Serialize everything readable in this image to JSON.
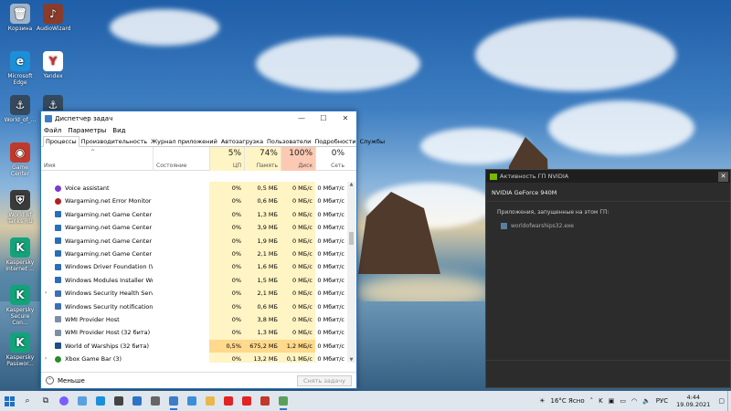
{
  "desktop": {
    "icons": [
      {
        "label": "Корзина",
        "color": "#9fb4c8",
        "glyph": "🗑"
      },
      {
        "label": "AudioWizard",
        "color": "#8a3b2a",
        "glyph": "♪"
      },
      {
        "label": "Microsoft Edge",
        "color": "#1c8fd8",
        "glyph": "e"
      },
      {
        "label": "Yandex",
        "color": "#ffffff",
        "glyph": "Y"
      },
      {
        "label": "World_of_...",
        "color": "#34495e",
        "glyph": "⚓"
      },
      {
        "label": "",
        "color": "#34495e",
        "glyph": "⚓"
      },
      {
        "label": "Game Center",
        "color": "#c0392b",
        "glyph": "◉"
      },
      {
        "label": "World of Tanks RU",
        "color": "#3a3a3a",
        "glyph": "⛨"
      },
      {
        "label": "Kaspersky Internet ...",
        "color": "#13a37a",
        "glyph": "K"
      },
      {
        "label": "Kaspersky Secure Con...",
        "color": "#13a37a",
        "glyph": "K"
      },
      {
        "label": "Kaspersky Passwor...",
        "color": "#13a37a",
        "glyph": "K"
      }
    ]
  },
  "taskmanager": {
    "title": "Диспетчер задач",
    "menu": [
      "Файл",
      "Параметры",
      "Вид"
    ],
    "tabs": [
      "Процессы",
      "Производительность",
      "Журнал приложений",
      "Автозагрузка",
      "Пользователи",
      "Подробности",
      "Службы"
    ],
    "active_tab": 0,
    "columns": {
      "name": "Имя",
      "state": "Состояние",
      "cpu": {
        "label": "ЦП",
        "pct": "5%"
      },
      "mem": {
        "label": "Память",
        "pct": "74%"
      },
      "disk": {
        "label": "Диск",
        "pct": "100%"
      },
      "net": {
        "label": "Сеть",
        "pct": "0%"
      }
    },
    "rows": [
      {
        "name": "Voice assistant",
        "icon": "voice",
        "expand": "",
        "cpu": "0%",
        "mem": "0,5 МБ",
        "disk": "0 МБ/с",
        "net": "0 Мбит/с"
      },
      {
        "name": "Wargaming.net Error Monitor (3...",
        "icon": "wg",
        "expand": "",
        "cpu": "0%",
        "mem": "0,6 МБ",
        "disk": "0 МБ/с",
        "net": "0 Мбит/с"
      },
      {
        "name": "Wargaming.net Game Center (3...",
        "icon": "win",
        "expand": "",
        "cpu": "0%",
        "mem": "1,3 МБ",
        "disk": "0 МБ/с",
        "net": "0 Мбит/с"
      },
      {
        "name": "Wargaming.net Game Center (3...",
        "icon": "win",
        "expand": "",
        "cpu": "0%",
        "mem": "3,9 МБ",
        "disk": "0 МБ/с",
        "net": "0 Мбит/с"
      },
      {
        "name": "Wargaming.net Game Center (3...",
        "icon": "win",
        "expand": "",
        "cpu": "0%",
        "mem": "1,9 МБ",
        "disk": "0 МБ/с",
        "net": "0 Мбит/с"
      },
      {
        "name": "Wargaming.net Game Center (3...",
        "icon": "win",
        "expand": "",
        "cpu": "0%",
        "mem": "2,1 МБ",
        "disk": "0 МБ/с",
        "net": "0 Мбит/с"
      },
      {
        "name": "Windows Driver Foundation (W...",
        "icon": "win",
        "expand": "",
        "cpu": "0%",
        "mem": "1,6 МБ",
        "disk": "0 МБ/с",
        "net": "0 Мбит/с"
      },
      {
        "name": "Windows Modules Installer Wor...",
        "icon": "win",
        "expand": "",
        "cpu": "0%",
        "mem": "1,5 МБ",
        "disk": "0 МБ/с",
        "net": "0 Мбит/с"
      },
      {
        "name": "Windows Security Health Service",
        "icon": "shield",
        "expand": "›",
        "cpu": "0%",
        "mem": "2,1 МБ",
        "disk": "0 МБ/с",
        "net": "0 Мбит/с"
      },
      {
        "name": "Windows Security notification ic...",
        "icon": "shield",
        "expand": "",
        "cpu": "0%",
        "mem": "0,6 МБ",
        "disk": "0 МБ/с",
        "net": "0 Мбит/с"
      },
      {
        "name": "WMI Provider Host",
        "icon": "wmi",
        "expand": "",
        "cpu": "0%",
        "mem": "3,8 МБ",
        "disk": "0 МБ/с",
        "net": "0 Мбит/с"
      },
      {
        "name": "WMI Provider Host (32 бита)",
        "icon": "wmi",
        "expand": "",
        "cpu": "0%",
        "mem": "1,3 МБ",
        "disk": "0 МБ/с",
        "net": "0 Мбит/с"
      },
      {
        "name": "World of Warships (32 бита)",
        "icon": "ship",
        "expand": "",
        "cpu": "0,5%",
        "mem": "675,2 МБ",
        "disk": "1,2 МБ/с",
        "net": "0 Мбит/с",
        "hot": true
      },
      {
        "name": "Xbox Game Bar (3)",
        "icon": "xbox",
        "expand": "›",
        "cpu": "0%",
        "mem": "13,2 МБ",
        "disk": "0,1 МБ/с",
        "net": "0 Мбит/с"
      }
    ],
    "footer": {
      "less": "Меньше",
      "end_task": "Снять задачу"
    }
  },
  "nvidia": {
    "title": "Активность ГП NVIDIA",
    "gpu": "NVIDIA GeForce 940M",
    "apps_label": "Приложения, запущенные на этом ГП:",
    "apps": [
      "worldofwarships32.exe"
    ]
  },
  "taskbar": {
    "weather": "16°C  Ясно",
    "lang": "РУС",
    "time": "4:44",
    "date": "19.09.2021",
    "pinned": [
      {
        "name": "cortana",
        "color": "#7a5cff",
        "running": false
      },
      {
        "name": "tablet",
        "color": "#5aa0e0",
        "running": false
      },
      {
        "name": "edge",
        "color": "#1c8fd8",
        "running": false
      },
      {
        "name": "store",
        "color": "#444444",
        "running": false
      },
      {
        "name": "mail",
        "color": "#2f73c9",
        "running": false
      },
      {
        "name": "settings",
        "color": "#666666",
        "running": false
      },
      {
        "name": "taskmgr",
        "color": "#3d7cc9",
        "running": true
      },
      {
        "name": "photos",
        "color": "#3a8fd8",
        "running": false
      },
      {
        "name": "explorer",
        "color": "#e8b84a",
        "running": false
      },
      {
        "name": "yandex",
        "color": "#e22424",
        "running": false
      },
      {
        "name": "yabrowser",
        "color": "#e22424",
        "running": false
      },
      {
        "name": "gamecenter",
        "color": "#c0392b",
        "running": false
      },
      {
        "name": "nvidia",
        "color": "#5aa05a",
        "running": true
      }
    ]
  }
}
